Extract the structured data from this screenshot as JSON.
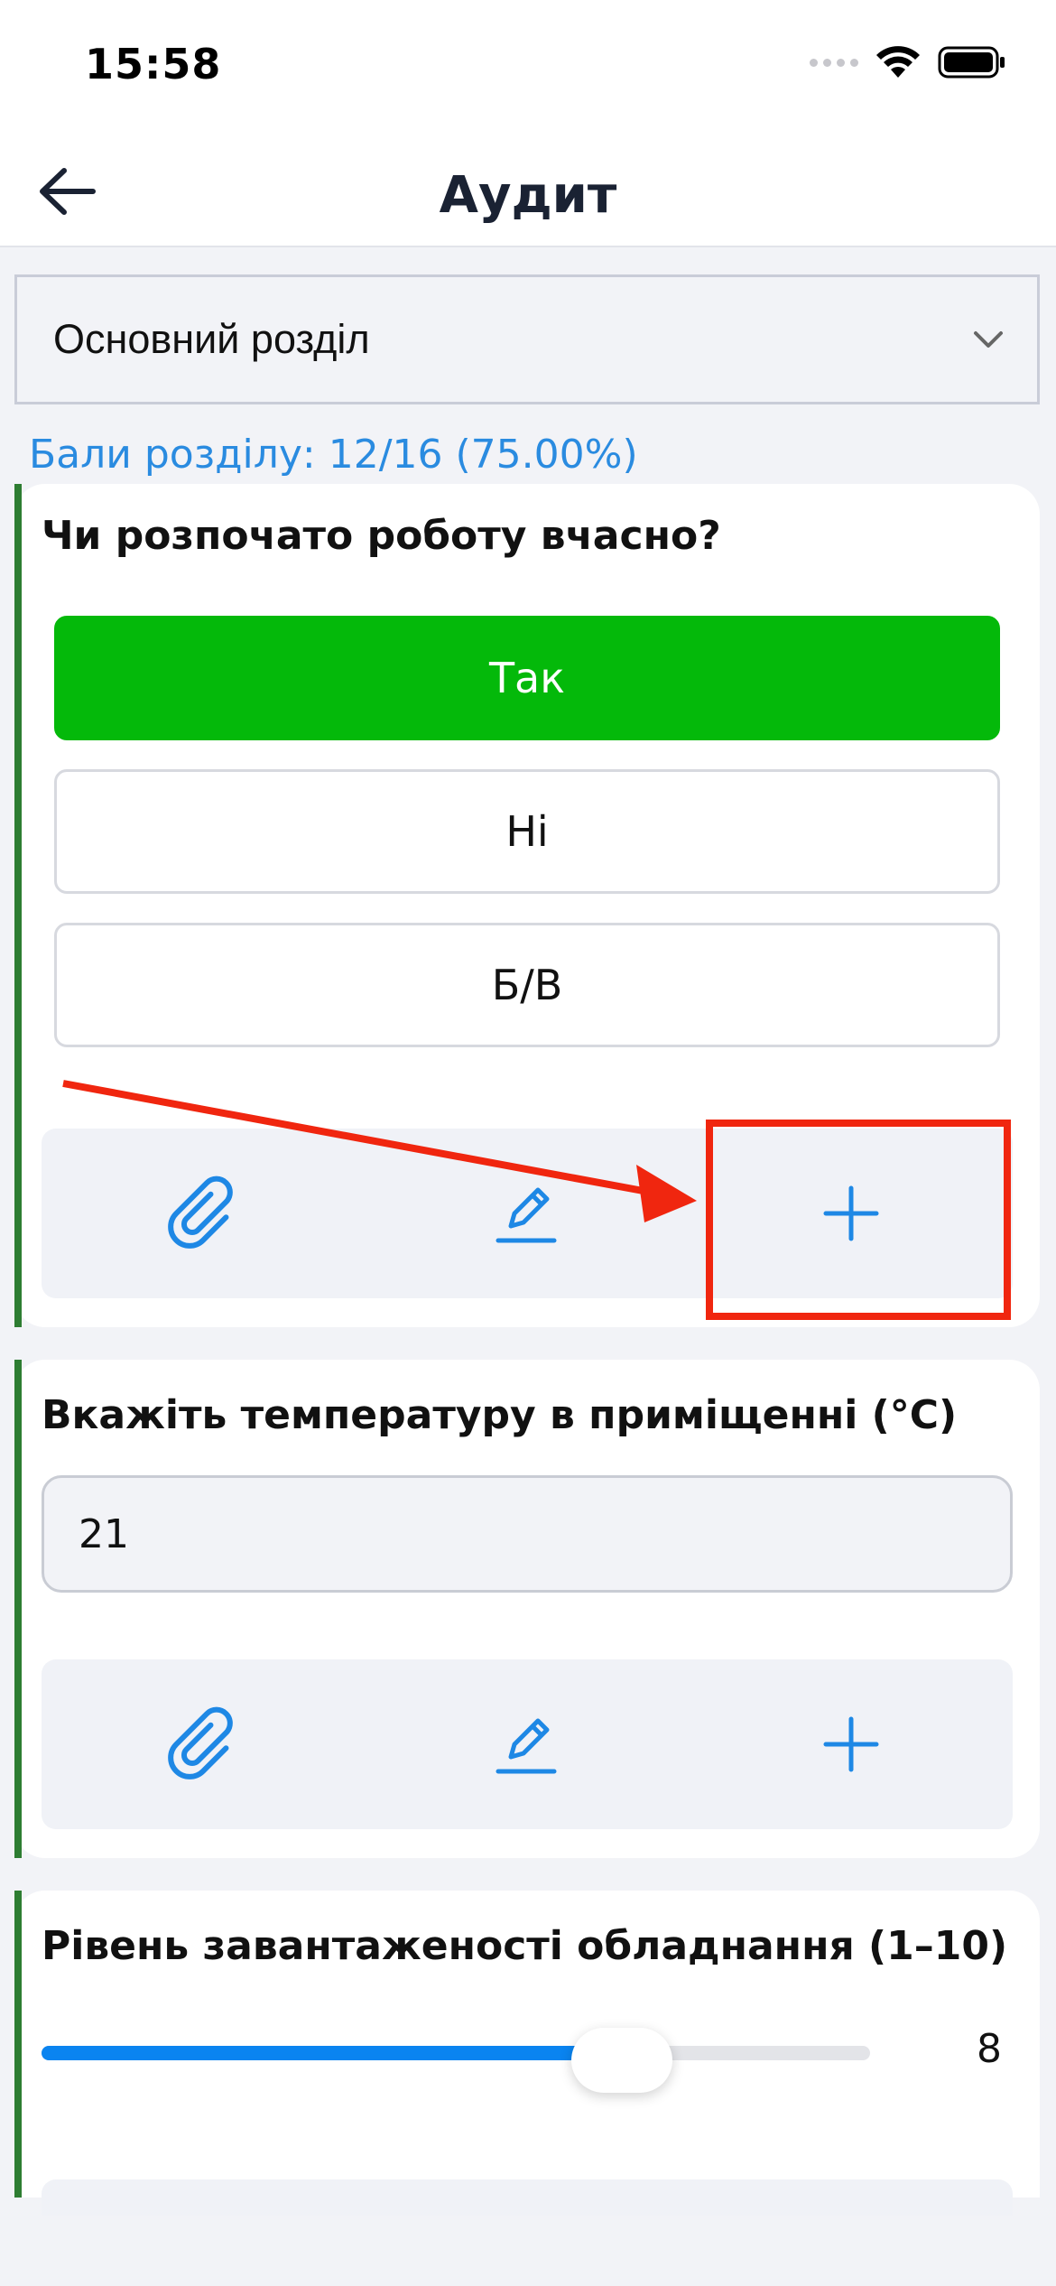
{
  "status_bar": {
    "time": "15:58"
  },
  "header": {
    "title": "Аудит",
    "back_icon": "arrow-left-icon"
  },
  "section": {
    "selected": "Основний розділ",
    "score_text": "Бали розділу: 12/16 (75.00%)"
  },
  "questions": [
    {
      "title": "Чи розпочато роботу вчасно?",
      "options": [
        "Так",
        "Ні",
        "Б/В"
      ],
      "selected_option": "Так"
    },
    {
      "title": "Вкажіть температуру в приміщенні (°C)",
      "value": "21"
    },
    {
      "title": "Рівень завантаженості обладнання (1–10)",
      "value": "8",
      "slider_fraction": 0.7
    }
  ],
  "actions": {
    "icons": [
      "paperclip-icon",
      "pencil-icon",
      "plus-icon"
    ]
  },
  "colors": {
    "accent": "#2a8be0",
    "selected_option": "#04b90a",
    "card_marker": "#2e7d32",
    "annotation": "#f0260f",
    "slider_fill": "#0a84f0"
  }
}
